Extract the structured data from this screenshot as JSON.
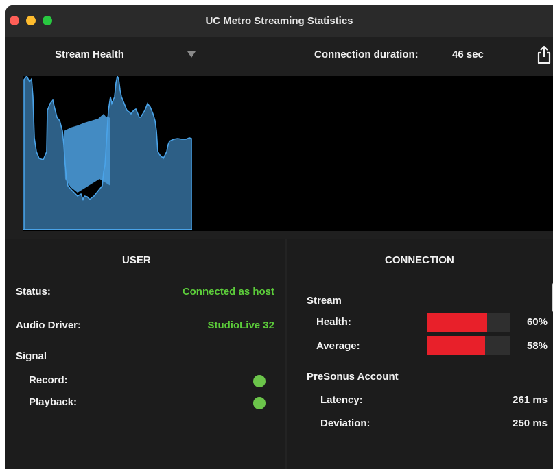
{
  "window": {
    "title": "UC Metro Streaming Statistics"
  },
  "toolbar": {
    "view_select": "Stream Health",
    "duration_label": "Connection duration:",
    "duration_value": "46 sec"
  },
  "graph": {
    "fill_color": "#2d5f86",
    "line_color": "#4aa3e8"
  },
  "user": {
    "heading": "USER",
    "status_label": "Status:",
    "status_value": "Connected as host",
    "driver_label": "Audio Driver:",
    "driver_value": "StudioLive 32",
    "signal_label": "Signal",
    "record_label": "Record:",
    "playback_label": "Playback:",
    "indicator_color": "#6bc44a"
  },
  "connection": {
    "heading": "CONNECTION",
    "stream_label": "Stream",
    "health_label": "Health:",
    "health_value": 0.6,
    "health_text": "60%",
    "average_label": "Average:",
    "average_value": 0.58,
    "average_text": "58%",
    "bar_color": "#e8202a",
    "account_label": "PreSonus Account",
    "latency_label": "Latency:",
    "latency_value": "261 ms",
    "deviation_label": "Deviation:",
    "deviation_value": "250 ms"
  }
}
